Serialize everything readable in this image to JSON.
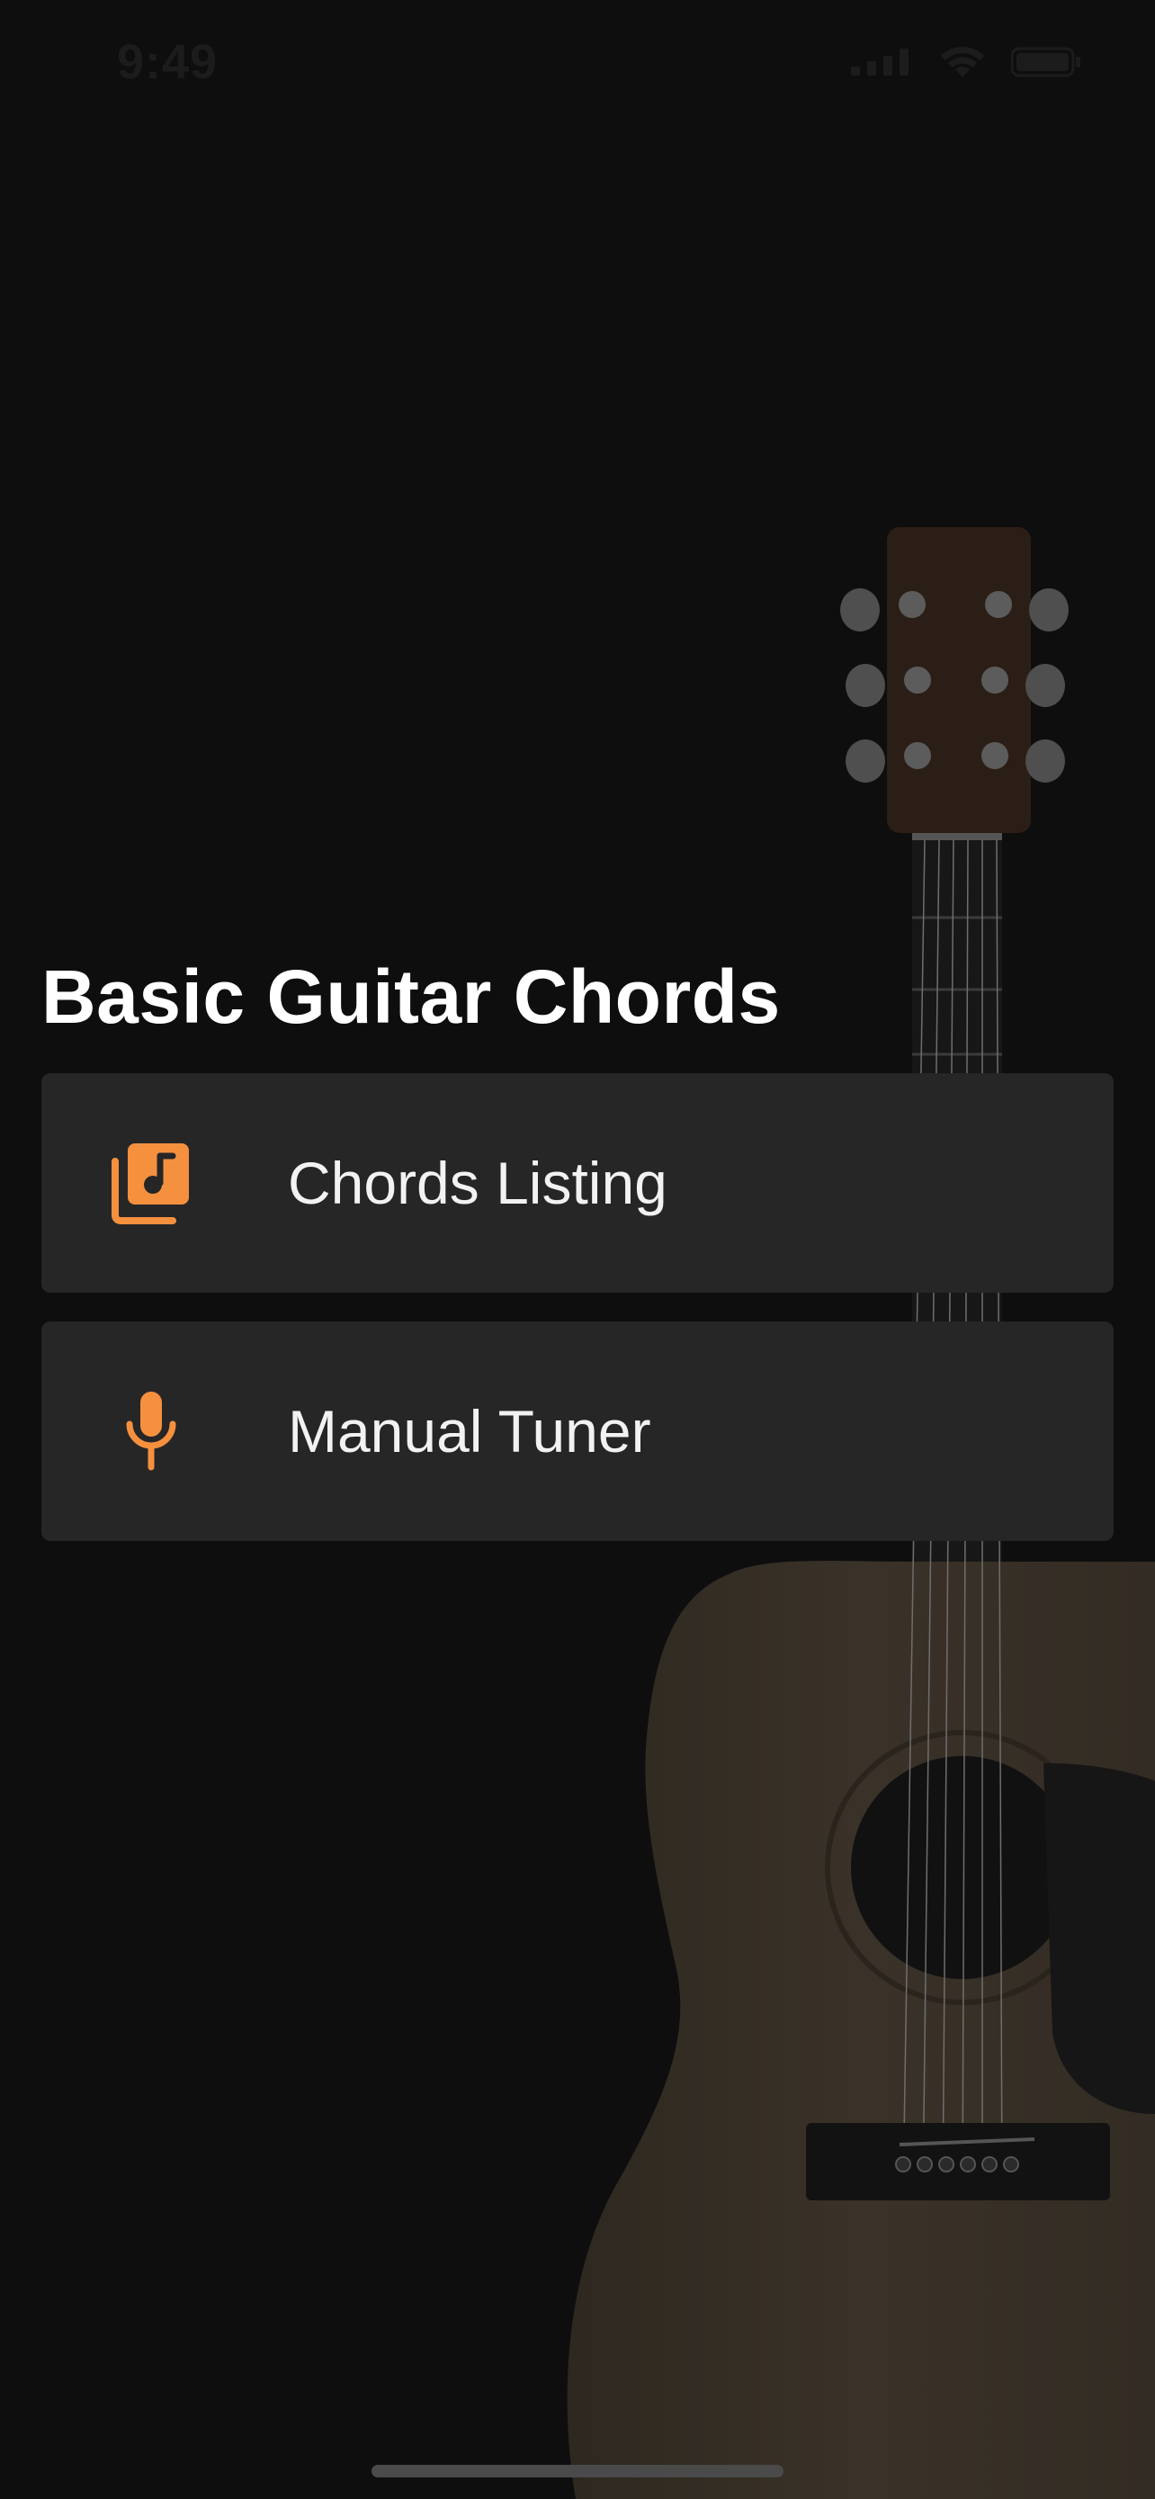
{
  "status_bar": {
    "time": "9:49",
    "icons": [
      "signal-icon",
      "wifi-icon",
      "battery-icon"
    ]
  },
  "page": {
    "title": "Basic Guitar Chords"
  },
  "menu": [
    {
      "label": "Chords Listing",
      "icon": "music-library-icon"
    },
    {
      "label": "Manual Tuner",
      "icon": "microphone-icon"
    }
  ],
  "colors": {
    "background": "#0e0e0e",
    "card": "#262627",
    "accent": "#f5903e",
    "text": "#ffffff"
  }
}
